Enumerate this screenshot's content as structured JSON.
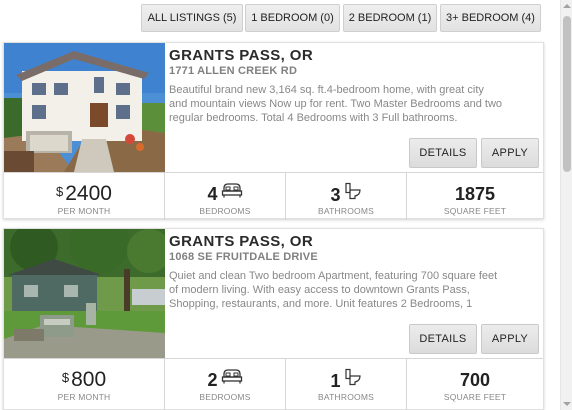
{
  "filters": [
    {
      "label": "ALL LISTINGS (5)"
    },
    {
      "label": "1 BEDROOM (0)"
    },
    {
      "label": "2 BEDROOM (1)"
    },
    {
      "label": "3+ BEDROOM (4)"
    }
  ],
  "listings": [
    {
      "city": "GRANTS PASS, OR",
      "street": "1771 ALLEN CREEK RD",
      "description": "Beautiful brand new 3,164 sq. ft.4-bedroom home, with great city and mountain views Now up for rent. Two Master Bedrooms and two regular bedrooms. Total 4 Bedrooms with 3 Full bathrooms.",
      "details_label": "DETAILS",
      "apply_label": "APPLY",
      "currency": "$",
      "price": "2400",
      "price_label": "PER MONTH",
      "bedrooms": "4",
      "bedrooms_label": "BEDROOMS",
      "bathrooms": "3",
      "bathrooms_label": "BATHROOMS",
      "sqft": "1875",
      "sqft_label": "SQUARE FEET"
    },
    {
      "city": "GRANTS PASS, OR",
      "street": "1068 SE FRUITDALE DRIVE",
      "description": "Quiet and clean Two bedroom Apartment, featuring 700 square feet of modern living. With easy access to downtown Grants Pass, Shopping, restaurants, and more. Unit features 2 Bedrooms, 1",
      "details_label": "DETAILS",
      "apply_label": "APPLY",
      "currency": "$",
      "price": "800",
      "price_label": "PER MONTH",
      "bedrooms": "2",
      "bedrooms_label": "BEDROOMS",
      "bathrooms": "1",
      "bathrooms_label": "BATHROOMS",
      "sqft": "700",
      "sqft_label": "SQUARE FEET"
    }
  ],
  "icons": {
    "bed": "bed-icon",
    "toilet": "toilet-icon"
  },
  "colors": {
    "button_bg": "#e4e4e4",
    "label_gray": "#888888"
  }
}
